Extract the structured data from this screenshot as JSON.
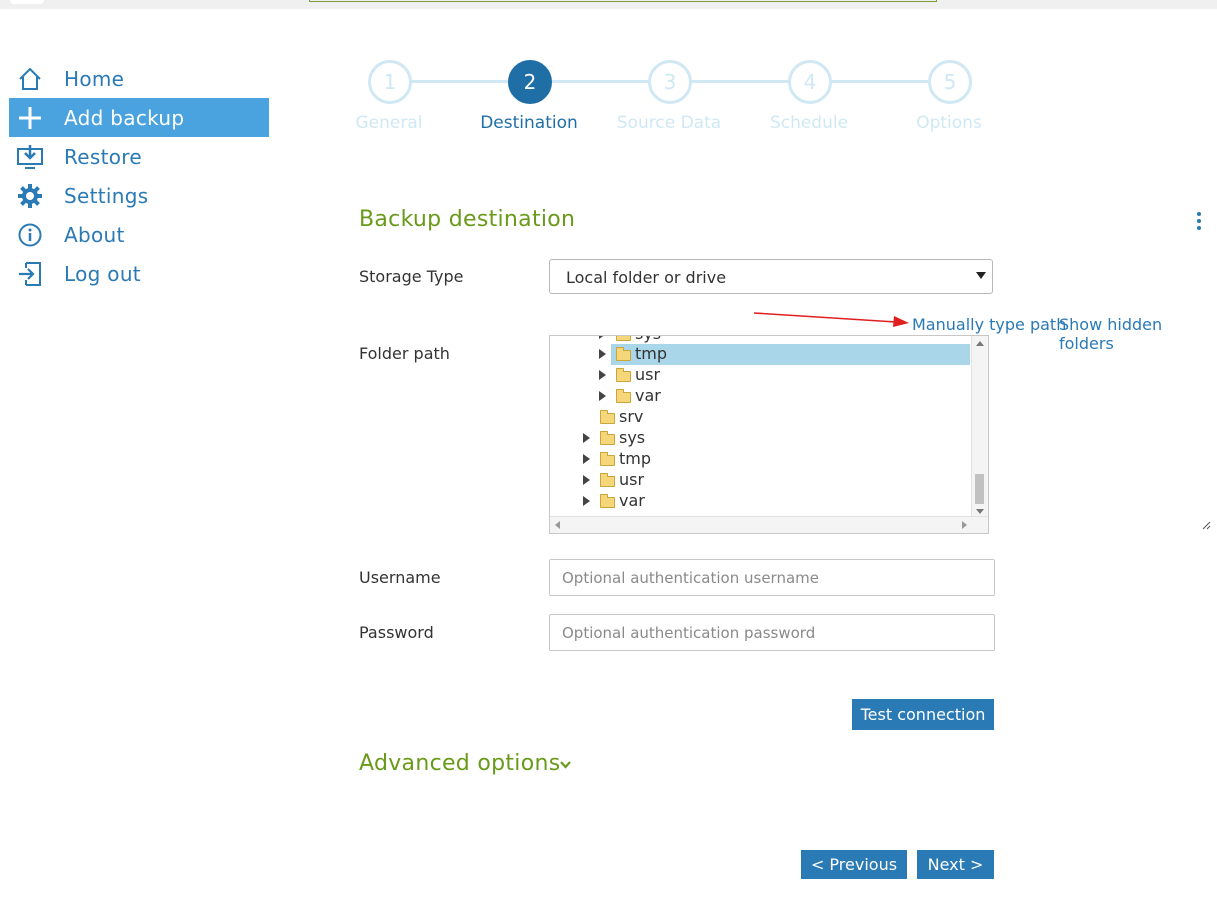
{
  "sidebar": {
    "items": [
      {
        "label": "Home",
        "icon": "home-icon"
      },
      {
        "label": "Add backup",
        "icon": "plus-icon",
        "active": true
      },
      {
        "label": "Restore",
        "icon": "restore-icon"
      },
      {
        "label": "Settings",
        "icon": "gear-icon"
      },
      {
        "label": "About",
        "icon": "info-icon"
      },
      {
        "label": "Log out",
        "icon": "logout-icon"
      }
    ]
  },
  "wizard": {
    "steps": [
      {
        "number": "1",
        "label": "General"
      },
      {
        "number": "2",
        "label": "Destination",
        "active": true
      },
      {
        "number": "3",
        "label": "Source Data"
      },
      {
        "number": "4",
        "label": "Schedule"
      },
      {
        "number": "5",
        "label": "Options"
      }
    ]
  },
  "form": {
    "title": "Backup destination",
    "storage_label": "Storage Type",
    "storage_value": "Local folder or drive",
    "manual_path_link": "Manually type path",
    "hidden_folders_link": "Show hidden folders",
    "folder_label": "Folder path",
    "tree": [
      {
        "name": "sys",
        "expandable": true,
        "depth": 1
      },
      {
        "name": "tmp",
        "expandable": true,
        "depth": 1,
        "selected": true
      },
      {
        "name": "usr",
        "expandable": true,
        "depth": 1
      },
      {
        "name": "var",
        "expandable": true,
        "depth": 1
      },
      {
        "name": "srv",
        "expandable": false,
        "depth": 0
      },
      {
        "name": "sys",
        "expandable": true,
        "depth": 0
      },
      {
        "name": "tmp",
        "expandable": true,
        "depth": 0
      },
      {
        "name": "usr",
        "expandable": true,
        "depth": 0
      },
      {
        "name": "var",
        "expandable": true,
        "depth": 0
      }
    ],
    "username_label": "Username",
    "username_placeholder": "Optional authentication username",
    "password_label": "Password",
    "password_placeholder": "Optional authentication password",
    "test_button": "Test connection",
    "advanced_label": "Advanced options"
  },
  "footer": {
    "previous": "< Previous",
    "next": "Next >"
  },
  "colors": {
    "accent": "#2a7ab5",
    "active_nav": "#4aa3df",
    "title_green": "#6a9a1a",
    "inactive_step": "#cfe8f4"
  }
}
